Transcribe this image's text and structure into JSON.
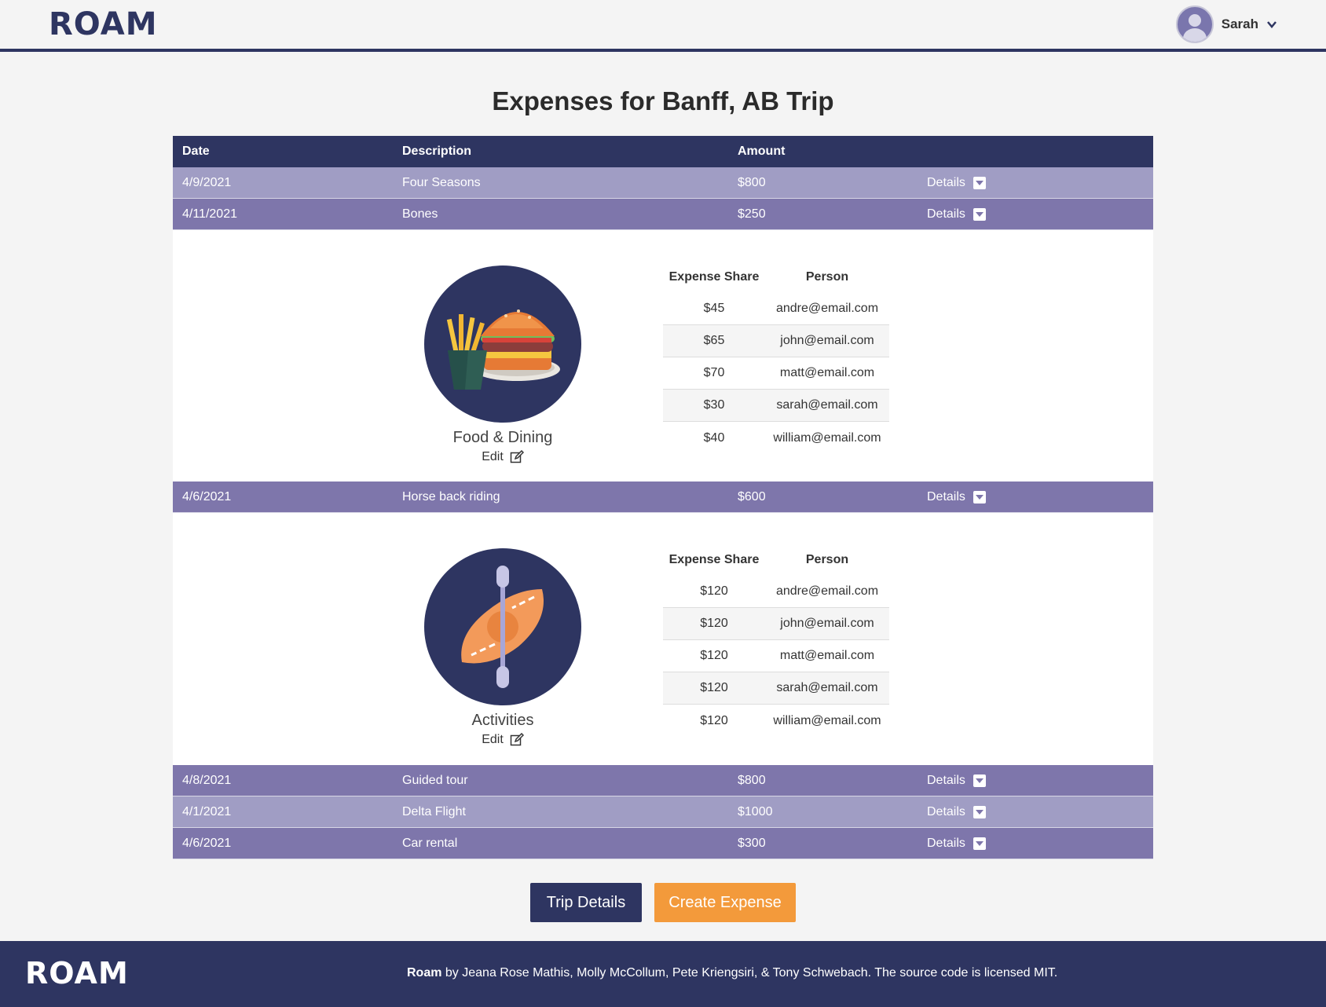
{
  "header": {
    "logo_text": "ROAM",
    "user_name": "Sarah"
  },
  "page_title": "Expenses for Banff, AB Trip",
  "table": {
    "columns": [
      "Date",
      "Description",
      "Amount"
    ],
    "details_label": "Details",
    "rows": [
      {
        "date": "4/9/2021",
        "description": "Four Seasons",
        "amount": "$800"
      },
      {
        "date": "4/11/2021",
        "description": "Bones",
        "amount": "$250"
      },
      {
        "date": "4/6/2021",
        "description": "Horse back riding",
        "amount": "$600"
      },
      {
        "date": "4/8/2021",
        "description": "Guided tour",
        "amount": "$800"
      },
      {
        "date": "4/1/2021",
        "description": "Delta Flight",
        "amount": "$1000"
      },
      {
        "date": "4/6/2021",
        "description": "Car rental",
        "amount": "$300"
      }
    ]
  },
  "expanded": [
    {
      "category": "Food & Dining",
      "icon": "burger-fries-icon",
      "edit_label": "Edit",
      "share_headers": [
        "Expense Share",
        "Person"
      ],
      "shares": [
        {
          "amount": "$45",
          "person": "andre@email.com"
        },
        {
          "amount": "$65",
          "person": "john@email.com"
        },
        {
          "amount": "$70",
          "person": "matt@email.com"
        },
        {
          "amount": "$30",
          "person": "sarah@email.com"
        },
        {
          "amount": "$40",
          "person": "william@email.com"
        }
      ]
    },
    {
      "category": "Activities",
      "icon": "kayak-icon",
      "edit_label": "Edit",
      "share_headers": [
        "Expense Share",
        "Person"
      ],
      "shares": [
        {
          "amount": "$120",
          "person": "andre@email.com"
        },
        {
          "amount": "$120",
          "person": "john@email.com"
        },
        {
          "amount": "$120",
          "person": "matt@email.com"
        },
        {
          "amount": "$120",
          "person": "sarah@email.com"
        },
        {
          "amount": "$120",
          "person": "william@email.com"
        }
      ]
    }
  ],
  "buttons": {
    "trip_details": "Trip Details",
    "create_expense": "Create Expense"
  },
  "footer": {
    "logo_text": "ROAM",
    "brand": "Roam",
    "credits": " by Jeana Rose Mathis, Molly McCollum, Pete Kriengsiri, & Tony Schwebach. The source code is licensed MIT."
  },
  "colors": {
    "navy": "#2e3561",
    "row_light": "#a09dc4",
    "row_dark": "#7e76ab",
    "orange": "#f39a3b"
  }
}
